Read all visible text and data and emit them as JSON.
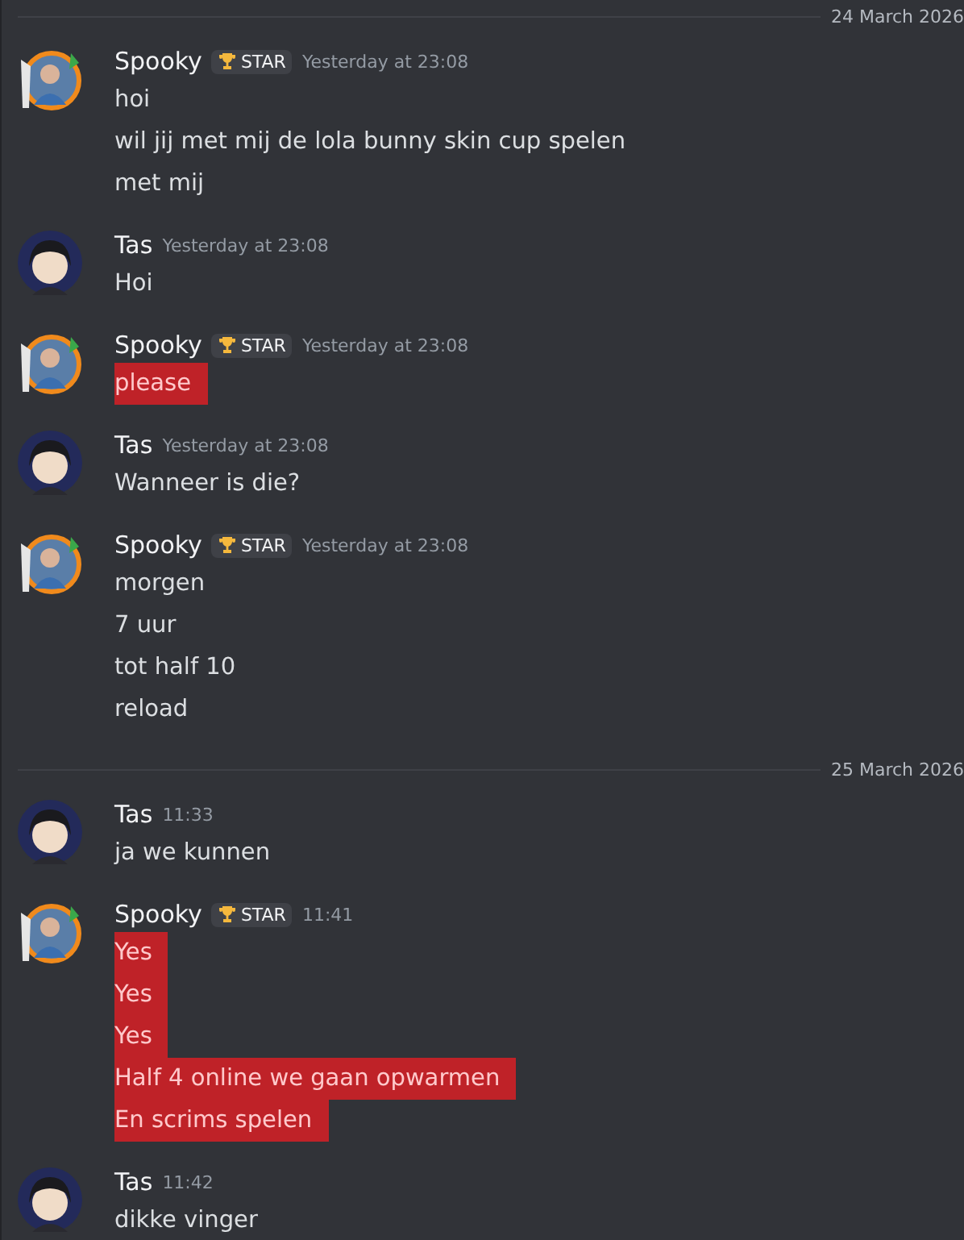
{
  "items": [
    {
      "kind": "divider",
      "date": "24 March 2026"
    },
    {
      "kind": "message",
      "author": "Spooky",
      "avatar": {
        "kind": "spooky"
      },
      "badge": {
        "label": "STAR"
      },
      "time": "Yesterday at 23:08",
      "lines": [
        {
          "text": "hoi",
          "redacted": false
        },
        {
          "text": "wil jij met mij de lola bunny skin cup spelen",
          "redacted": false
        },
        {
          "text": "met mij",
          "redacted": false
        }
      ]
    },
    {
      "kind": "message",
      "author": "Tas",
      "avatar": {
        "kind": "tas"
      },
      "time": "Yesterday at 23:08",
      "lines": [
        {
          "text": "Hoi",
          "redacted": false
        }
      ]
    },
    {
      "kind": "message",
      "author": "Spooky",
      "avatar": {
        "kind": "spooky"
      },
      "badge": {
        "label": "STAR"
      },
      "time": "Yesterday at 23:08",
      "lines": [
        {
          "text": "please",
          "redacted": true
        }
      ]
    },
    {
      "kind": "message",
      "author": "Tas",
      "avatar": {
        "kind": "tas"
      },
      "time": "Yesterday at 23:08",
      "lines": [
        {
          "text": "Wanneer is die?",
          "redacted": false
        }
      ]
    },
    {
      "kind": "message",
      "author": "Spooky",
      "avatar": {
        "kind": "spooky"
      },
      "badge": {
        "label": "STAR"
      },
      "time": "Yesterday at 23:08",
      "lines": [
        {
          "text": "morgen",
          "redacted": false
        },
        {
          "text": "7 uur",
          "redacted": false
        },
        {
          "text": "tot half 10",
          "redacted": false
        },
        {
          "text": "reload",
          "redacted": false
        }
      ]
    },
    {
      "kind": "divider",
      "date": "25 March 2026"
    },
    {
      "kind": "message",
      "author": "Tas",
      "avatar": {
        "kind": "tas"
      },
      "time": "11:33",
      "lines": [
        {
          "text": "ja we kunnen",
          "redacted": false
        }
      ]
    },
    {
      "kind": "message",
      "author": "Spooky",
      "avatar": {
        "kind": "spooky"
      },
      "badge": {
        "label": "STAR"
      },
      "time": "11:41",
      "lines": [
        {
          "text": "Yes",
          "redacted": true
        },
        {
          "text": "Yes",
          "redacted": true
        },
        {
          "text": "Yes",
          "redacted": true
        },
        {
          "text": "Half 4 online we gaan opwarmen",
          "redacted": true
        },
        {
          "text": "En scrims spelen",
          "redacted": true
        }
      ]
    },
    {
      "kind": "message",
      "author": "Tas",
      "avatar": {
        "kind": "tas"
      },
      "time": "11:42",
      "lines": [
        {
          "text": "dikke vinger",
          "redacted": false
        }
      ]
    }
  ]
}
